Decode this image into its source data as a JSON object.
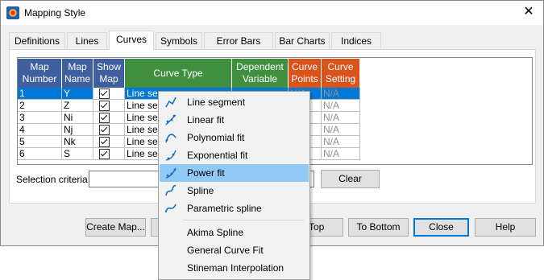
{
  "window": {
    "title": "Mapping Style",
    "close_glyph": "✕",
    "icon": "app-logo-icon"
  },
  "tabs": [
    {
      "label": "Definitions",
      "active": false
    },
    {
      "label": "Lines",
      "active": false
    },
    {
      "label": "Curves",
      "active": true
    },
    {
      "label": "Symbols",
      "active": false
    },
    {
      "label": "Error Bars",
      "active": false
    },
    {
      "label": "Bar Charts",
      "active": false
    },
    {
      "label": "Indices",
      "active": false
    }
  ],
  "grid": {
    "columns": [
      {
        "label": "Map Number",
        "color": "#3f5f9f"
      },
      {
        "label": "Map Name",
        "color": "#3f5f9f"
      },
      {
        "label": "Show Map",
        "color": "#3f5f9f"
      },
      {
        "label": "Curve Type",
        "color": "#3f8f3f"
      },
      {
        "label": "Dependent Variable",
        "color": "#3f8f3f"
      },
      {
        "label": "Curve Points",
        "color": "#d9541a"
      },
      {
        "label": "Curve Setting",
        "color": "#d9541a"
      }
    ],
    "rows": [
      {
        "num": "1",
        "name": "Y",
        "show": true,
        "curve": "Line seg",
        "dep": "",
        "points": "N/A",
        "setting": "N/A",
        "selected": true
      },
      {
        "num": "2",
        "name": "Z",
        "show": true,
        "curve": "Line seg",
        "dep": "",
        "points": "N/A",
        "setting": "N/A",
        "selected": false
      },
      {
        "num": "3",
        "name": "Ni",
        "show": true,
        "curve": "Line seg",
        "dep": "",
        "points": "N/A",
        "setting": "N/A",
        "selected": false
      },
      {
        "num": "4",
        "name": "Nj",
        "show": true,
        "curve": "Line seg",
        "dep": "",
        "points": "N/A",
        "setting": "N/A",
        "selected": false
      },
      {
        "num": "5",
        "name": "Nk",
        "show": true,
        "curve": "Line seg",
        "dep": "",
        "points": "N/A",
        "setting": "N/A",
        "selected": false
      },
      {
        "num": "6",
        "name": "S",
        "show": true,
        "curve": "Line seg",
        "dep": "",
        "points": "N/A",
        "setting": "N/A",
        "selected": false
      }
    ]
  },
  "selection": {
    "label": "Selection criteria:",
    "value": "",
    "clear_label": "Clear"
  },
  "buttons": {
    "create_map": "Create Map...",
    "to_top": "Top",
    "to_bottom": "To Bottom",
    "close": "Close",
    "help": "Help"
  },
  "dropdown": {
    "items": [
      {
        "label": "Line segment",
        "icon": "line-segment-icon",
        "highlighted": false
      },
      {
        "label": "Linear fit",
        "icon": "linear-fit-icon",
        "highlighted": false
      },
      {
        "label": "Polynomial fit",
        "icon": "polynomial-fit-icon",
        "highlighted": false
      },
      {
        "label": "Exponential fit",
        "icon": "exponential-fit-icon",
        "highlighted": false
      },
      {
        "label": "Power fit",
        "icon": "power-fit-icon",
        "highlighted": true
      },
      {
        "label": "Spline",
        "icon": "spline-icon",
        "highlighted": false
      },
      {
        "label": "Parametric spline",
        "icon": "parametric-spline-icon",
        "highlighted": false
      },
      {
        "label": "Akima Spline",
        "icon": "",
        "highlighted": false
      },
      {
        "label": "General Curve Fit",
        "icon": "",
        "highlighted": false
      },
      {
        "label": "Stineman Interpolation",
        "icon": "",
        "highlighted": false
      }
    ]
  }
}
